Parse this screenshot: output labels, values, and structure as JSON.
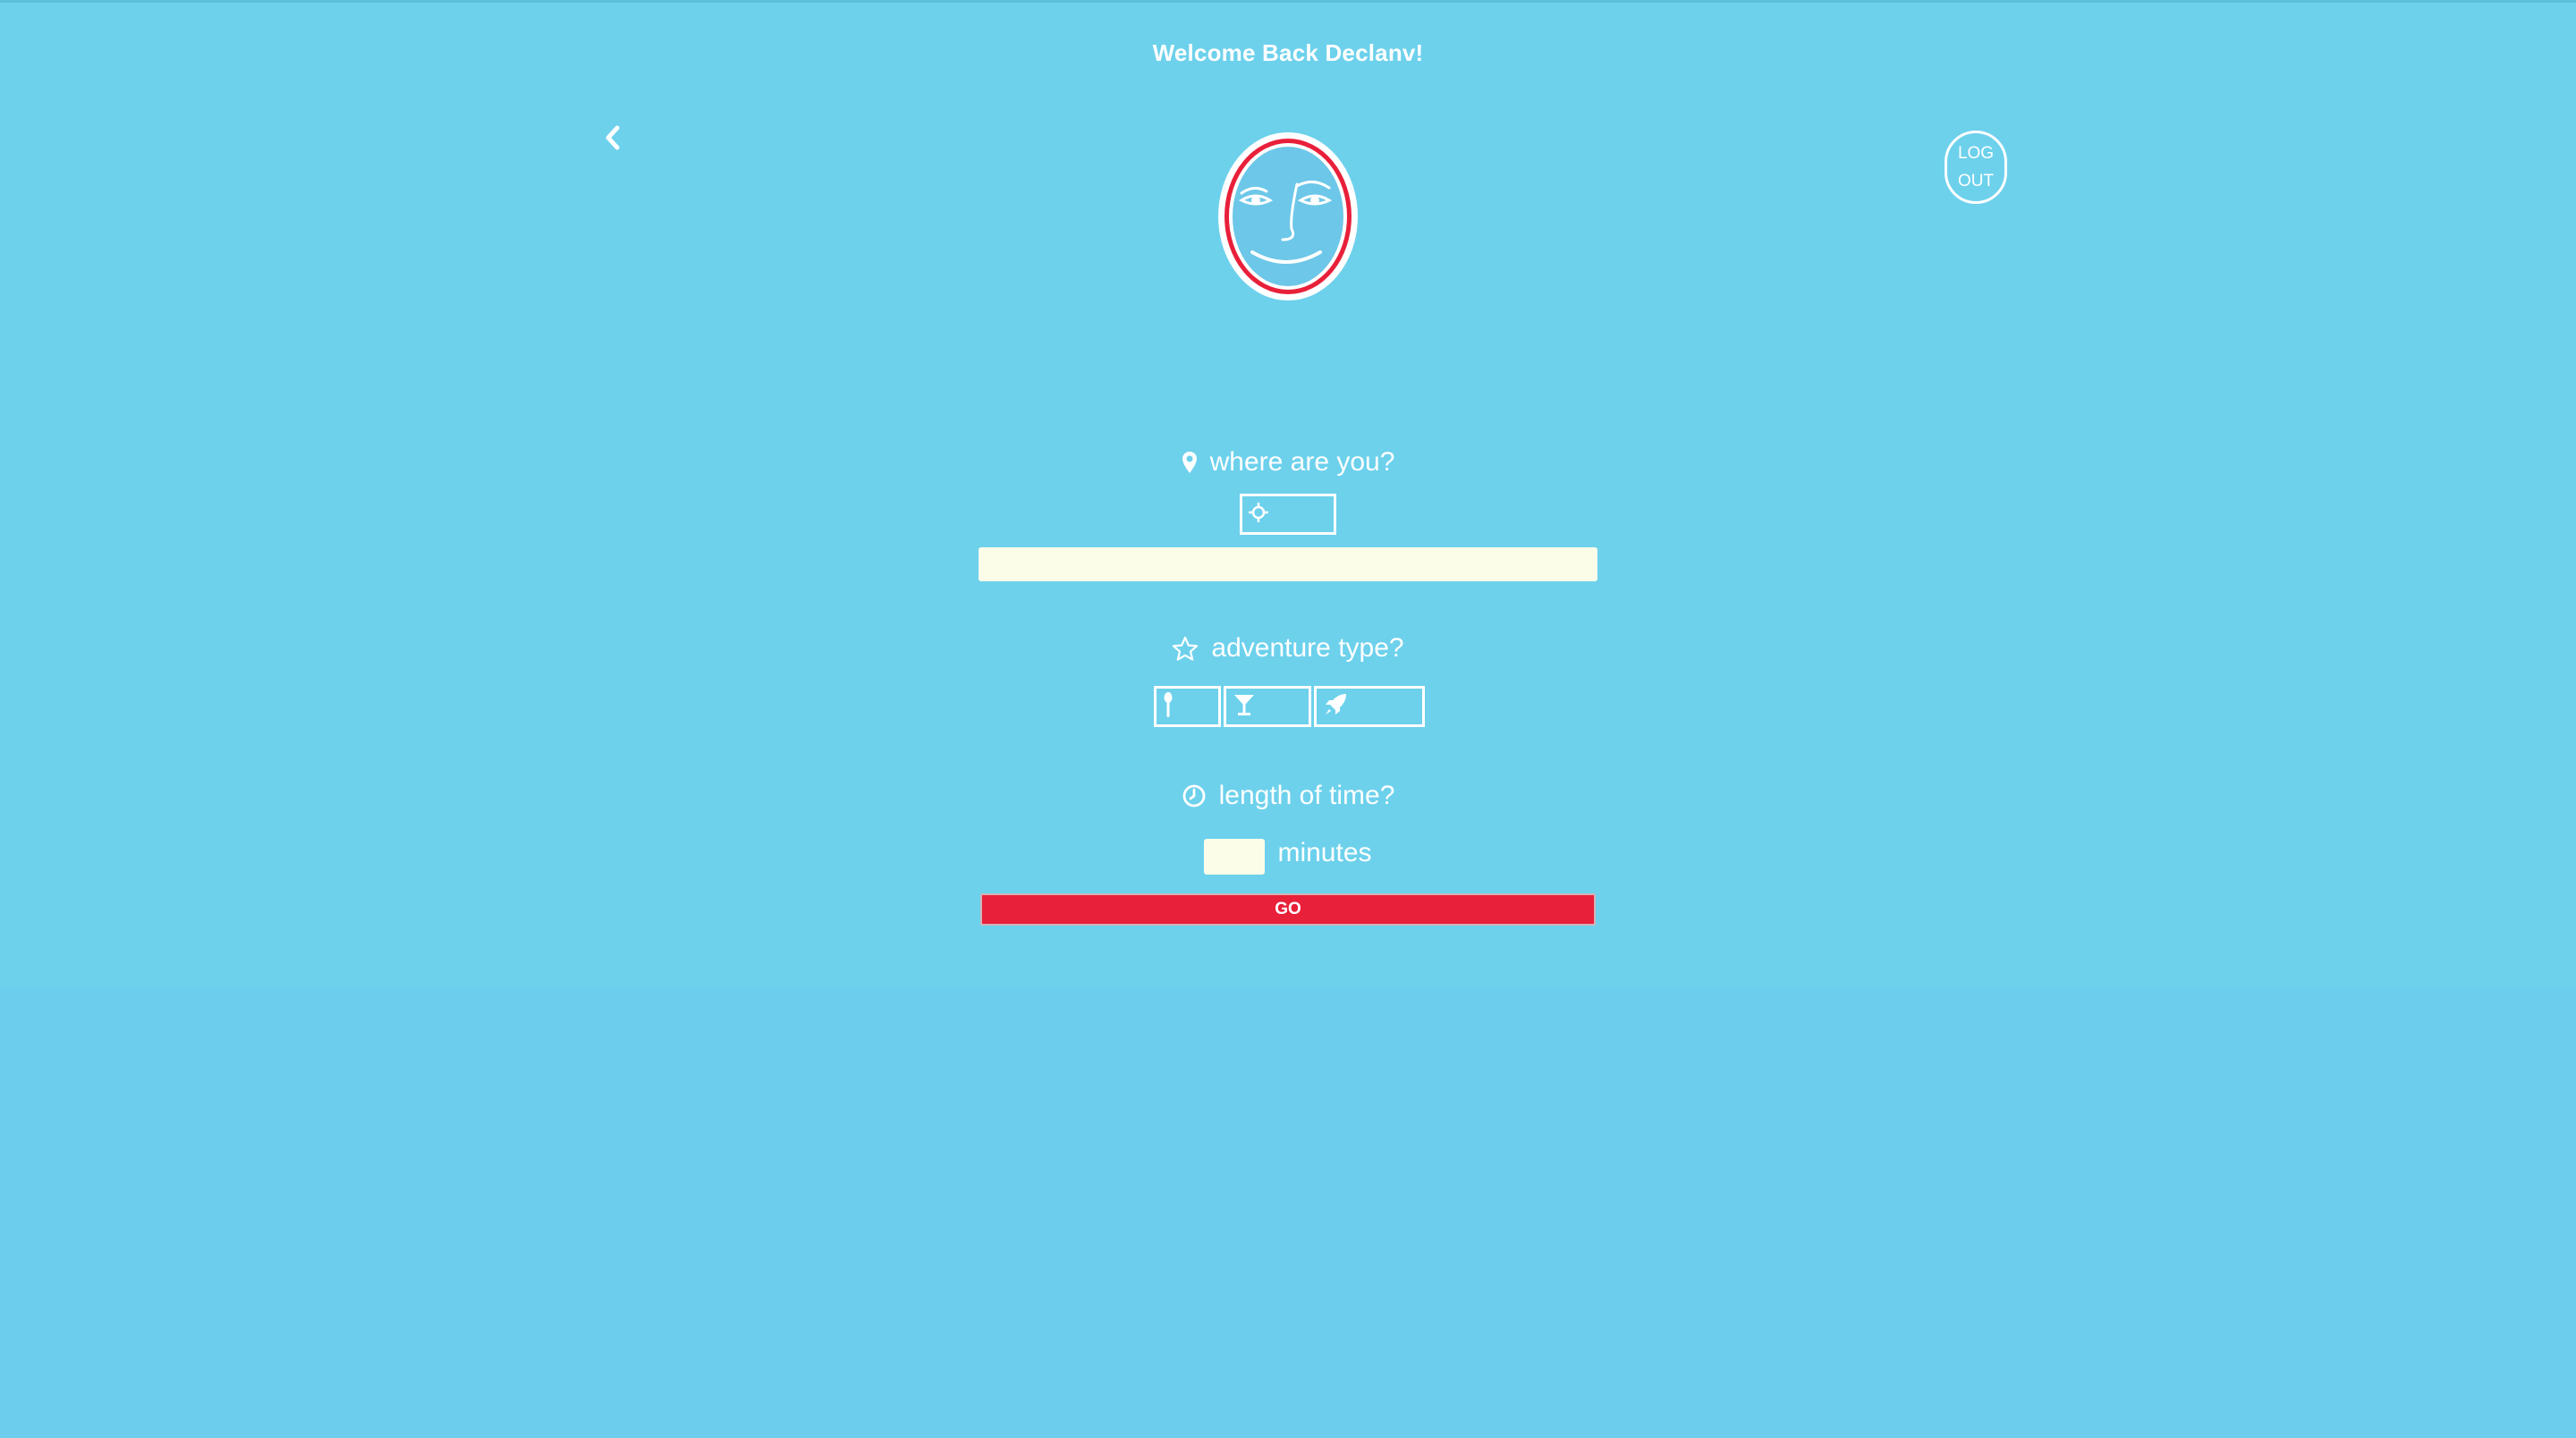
{
  "header": {
    "welcome_text": "Welcome Back Declanv!"
  },
  "nav": {
    "back_icon": "chevron-left-icon",
    "logout_line1": "LOG",
    "logout_line2": "OUT"
  },
  "avatar": {
    "icon": "smiling-face-icon"
  },
  "location": {
    "label": "where are you?",
    "icon": "map-marker-icon",
    "locate_icon": "crosshair-icon",
    "input_value": "",
    "input_placeholder": ""
  },
  "adventure": {
    "label": "adventure type?",
    "icon": "star-icon",
    "options": [
      {
        "icon": "spoon-icon"
      },
      {
        "icon": "cocktail-icon"
      },
      {
        "icon": "rocket-icon"
      }
    ]
  },
  "time": {
    "label": "length of time?",
    "icon": "clock-icon",
    "minutes_value": "",
    "minutes_label": "minutes"
  },
  "actions": {
    "go_label": "GO"
  },
  "colors": {
    "background": "#6dd1ec",
    "accent_red": "#e8203a",
    "input_bg": "#fbfde9"
  }
}
